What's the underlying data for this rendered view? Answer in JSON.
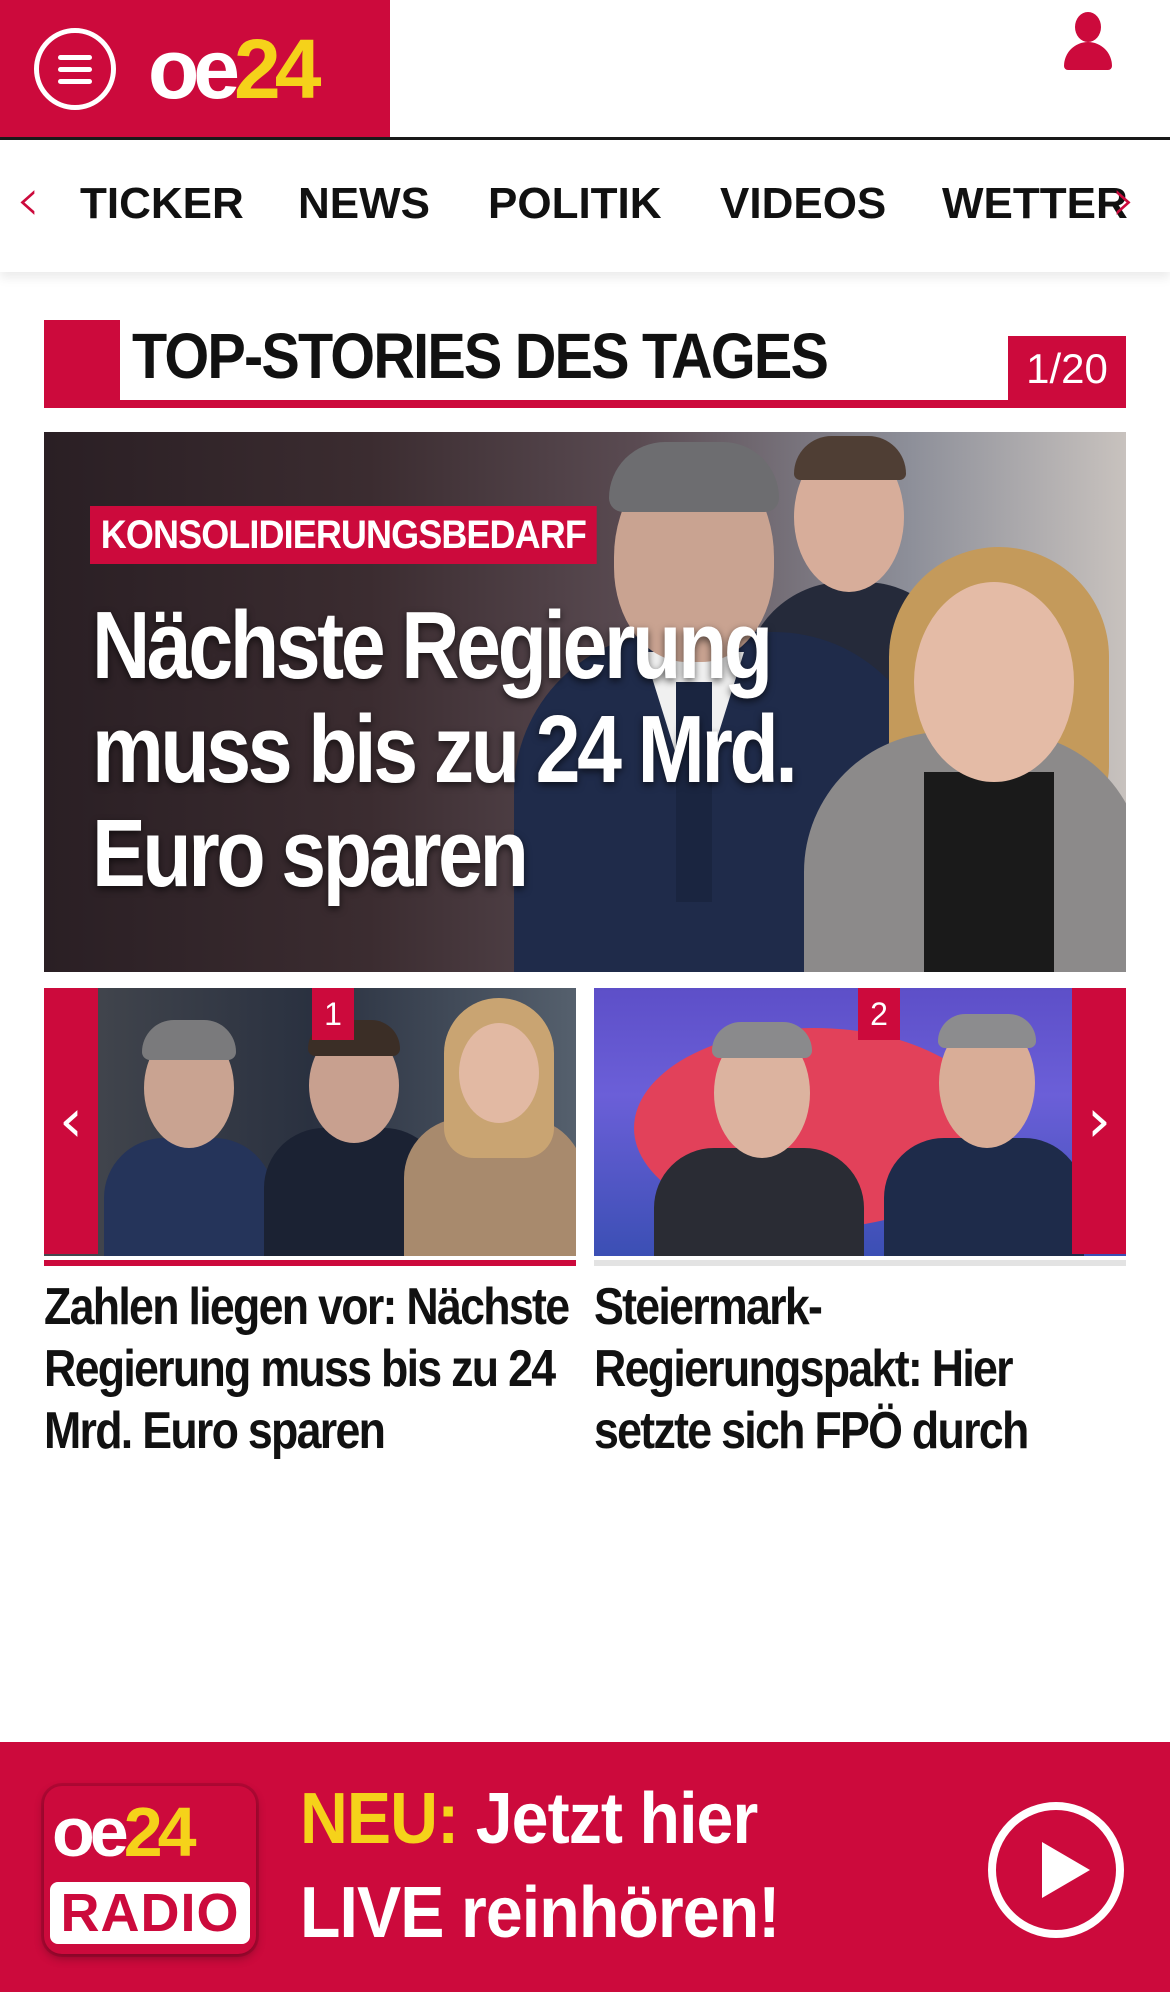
{
  "header": {
    "menu_icon": "hamburger-menu-icon",
    "logo_part1": "oe",
    "logo_part2": "24",
    "user_icon": "user-icon"
  },
  "nav": {
    "prev_icon": "‹",
    "next_icon": "›",
    "items": [
      {
        "label": "TICKER"
      },
      {
        "label": "NEWS"
      },
      {
        "label": "POLITIK"
      },
      {
        "label": "VIDEOS"
      },
      {
        "label": "WETTER"
      }
    ]
  },
  "section": {
    "title": "TOP-STORIES DES TAGES",
    "counter": "1/20"
  },
  "hero": {
    "tag": "KONSOLIDIERUNGSBEDARF",
    "headline": "Nächste Regierung muss bis zu 24 Mrd. Euro sparen"
  },
  "slider": {
    "prev_icon": "‹",
    "next_icon": "›"
  },
  "cards": [
    {
      "badge": "1",
      "title": "Zahlen liegen vor: Nächste Regierung muss bis zu 24 Mrd. Euro sparen"
    },
    {
      "badge": "2",
      "title": "Steiermark-Regierungspakt: Hier setzte sich FPÖ durch"
    }
  ],
  "radio": {
    "logo_part1": "oe",
    "logo_part2": "24",
    "logo_sub": "RADIO",
    "neu": "NEU:",
    "line1": "Jetzt hier",
    "line2": "LIVE reinhören!",
    "play_icon": "play-icon"
  },
  "colors": {
    "brand_red": "#cc0a3c",
    "brand_yellow": "#f5d21a"
  }
}
